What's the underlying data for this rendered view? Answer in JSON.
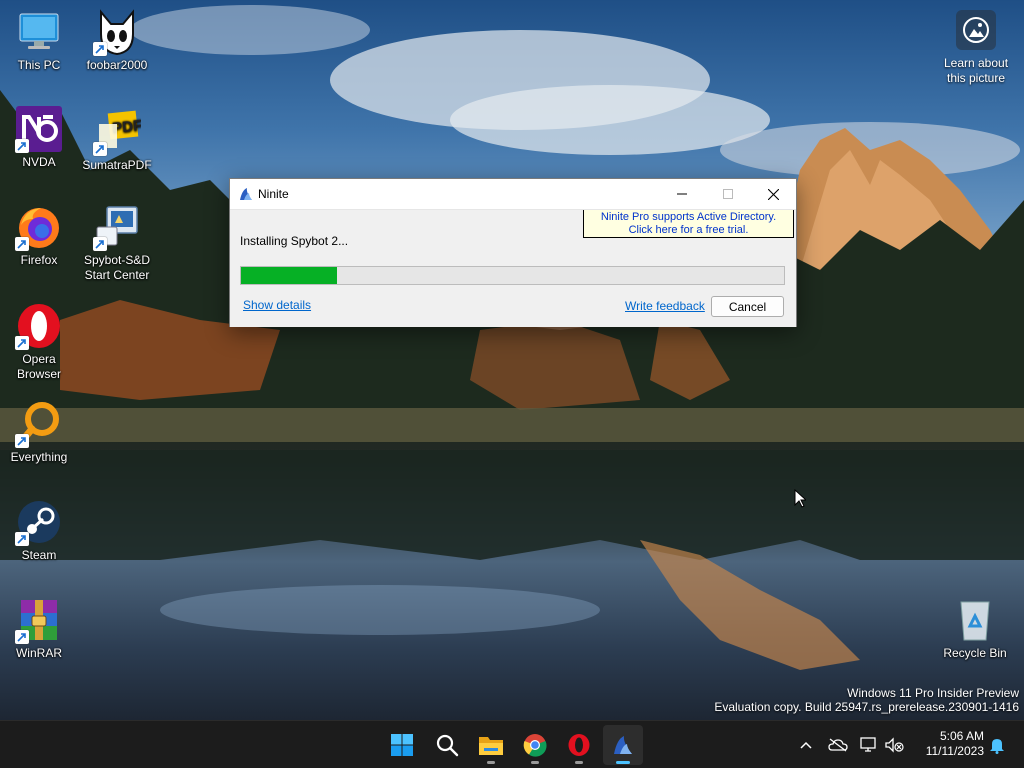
{
  "desktop": {
    "icons": [
      {
        "id": "this-pc",
        "label": "This PC"
      },
      {
        "id": "foobar2000",
        "label": "foobar2000"
      },
      {
        "id": "nvda",
        "label": "NVDA"
      },
      {
        "id": "sumatrapdf",
        "label": "SumatraPDF"
      },
      {
        "id": "firefox",
        "label": "Firefox"
      },
      {
        "id": "spybot",
        "label": "Spybot-S&D Start Center"
      },
      {
        "id": "opera",
        "label": "Opera Browser"
      },
      {
        "id": "everything",
        "label": "Everything"
      },
      {
        "id": "steam",
        "label": "Steam"
      },
      {
        "id": "winrar",
        "label": "WinRAR"
      },
      {
        "id": "recycle-bin",
        "label": "Recycle Bin"
      }
    ],
    "learn_about": "Learn about this picture",
    "watermark": {
      "line1": "Windows 11 Pro Insider Preview",
      "line2": "Evaluation copy. Build 25947.rs_prerelease.230901-1416"
    }
  },
  "ninite": {
    "title": "Ninite",
    "promo_line1": "Ninite Pro supports Active Directory.",
    "promo_line2": "Click here for a free trial.",
    "status": "Installing Spybot 2...",
    "progress_fraction": 0.176,
    "show_details": "Show details",
    "write_feedback": "Write feedback",
    "cancel": "Cancel"
  },
  "taskbar": {
    "apps": [
      "start-icon",
      "search-icon",
      "file-explorer-icon",
      "chrome-icon",
      "opera-icon",
      "ninite-icon"
    ],
    "time": "5:06 AM",
    "date": "11/11/2023"
  },
  "colors": {
    "progress_fill": "#06b025",
    "link": "#0066cc",
    "taskbar": "#1c1c1c",
    "accent": "#4cc2ff"
  }
}
